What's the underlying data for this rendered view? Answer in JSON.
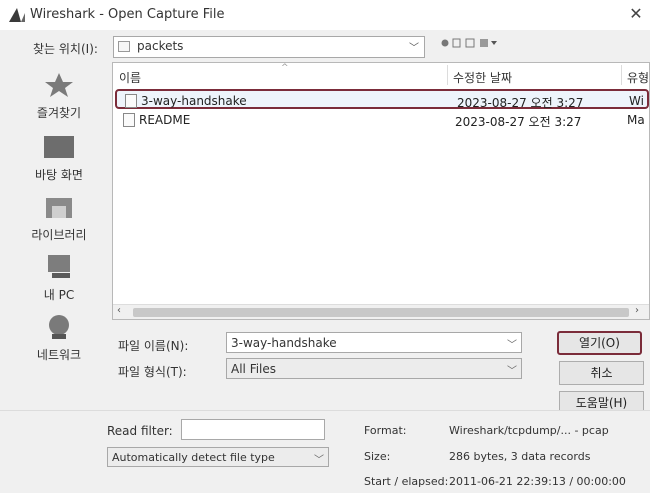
{
  "window": {
    "title": "Wireshark - Open Capture File",
    "close_glyph": "✕"
  },
  "lookin": {
    "label": "찾는 위치(I):",
    "value": "packets"
  },
  "places": [
    {
      "label": "즐겨찾기",
      "icon": "star-icon"
    },
    {
      "label": "바탕 화면",
      "icon": "desktop-icon"
    },
    {
      "label": "라이브러리",
      "icon": "library-icon"
    },
    {
      "label": "내 PC",
      "icon": "computer-icon"
    },
    {
      "label": "네트워크",
      "icon": "network-icon"
    }
  ],
  "filelist": {
    "columns": [
      "이름",
      "수정한 날짜",
      "유형"
    ],
    "rows": [
      {
        "name": "3-way-handshake",
        "date": "2023-08-27 오전 3:27",
        "type": "Wi",
        "selected": true
      },
      {
        "name": "README",
        "date": "2023-08-27 오전 3:27",
        "type": "Ma",
        "selected": false
      }
    ]
  },
  "filename": {
    "label": "파일 이름(N):",
    "value": "3-way-handshake"
  },
  "filetype": {
    "label": "파일 형식(T):",
    "value": "All Files"
  },
  "buttons": {
    "open": "열기(O)",
    "cancel": "취소",
    "help": "도움말(H)"
  },
  "read_filter": {
    "label": "Read filter:",
    "value": ""
  },
  "format_detect": {
    "value": "Automatically detect file type"
  },
  "capture_info": {
    "format_label": "Format:",
    "format_value": "Wireshark/tcpdump/... - pcap",
    "size_label": "Size:",
    "size_value": "286 bytes, 3 data records",
    "start_label": "Start / elapsed:",
    "start_value": "2011-06-21 22:39:13 / 00:00:00"
  },
  "colors": {
    "highlight_border": "#7b2c3a",
    "dialog_bg": "#f0f0f0"
  }
}
